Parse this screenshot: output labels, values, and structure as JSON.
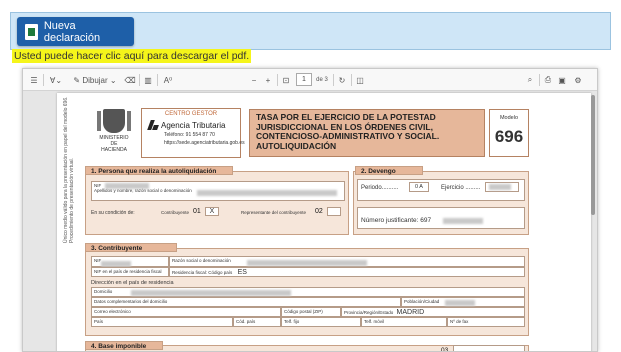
{
  "top": {
    "button_label": "Nueva declaración",
    "hint": "Usted puede hacer clic aquí para descargar el pdf."
  },
  "toolbar": {
    "draw_label": "Dibujar",
    "page_current": "1",
    "page_total": "de 3",
    "text_tool": "A⁰"
  },
  "form": {
    "side_text": "Único medio válido para la presentación en papel del modelo 696. Procedimiento de presentación virtual.",
    "crest_label": "MINISTERIO DE HACIENDA",
    "gestor_head": "CENTRO GESTOR",
    "agency": "Agencia Tributaria",
    "phone": "Teléfono: 91 554 87 70",
    "url": "https://sede.agenciatributaria.gob.es",
    "title": "TASA POR EL EJERCICIO DE LA POTESTAD JURISDICCIONAL EN LOS ÓRDENES CIVIL, CONTENCIOSO-ADMINISTRATIVO Y SOCIAL. AUTOLIQUIDACIÓN",
    "modelo_label": "Modelo",
    "modelo_num": "696",
    "s1_title": "1. Persona que realiza la autoliquidación",
    "s1_nif": "NIF",
    "s1_name": "Apellidos y nombre, razón social o denominación",
    "s1_cond": "En su condición de:",
    "s1_contrib": "Contribuyente",
    "s1_code1": "01",
    "s1_x1": "X",
    "s1_repr": "Representante del contribuyente",
    "s1_code2": "02",
    "s1_x2": "",
    "s2_title": "2. Devengo",
    "s2_periodo": "Periodo..........",
    "s2_per_val": "0 A",
    "s2_ejercicio": "Ejercicio .........",
    "s2_justif": "Número justificante: 697",
    "s3_title": "3. Contribuyente",
    "s3_nif": "NIF",
    "s3_razon": "Razón social o denominación",
    "s3_nif_res": "NIF en el país de residencia fiscal",
    "s3_res_fiscal": "Residencia fiscal: Código país",
    "s3_res_val": "ES",
    "s3_dir_head": "Dirección en el país de residencia",
    "s3_domicilio": "Domicilio",
    "s3_complement": "Datos complementarios del domicilio",
    "s3_poblacion": "Población/Ciudad",
    "s3_correo": "Correo electrónico",
    "s3_cp": "Código postal (ZIP)",
    "s3_provincia": "Provincia/Región/Estado",
    "s3_prov_val": "MADRID",
    "s3_pais": "País",
    "s3_cod_pais": "Cód. país",
    "s3_tel_fijo": "Telf. fijo",
    "s3_tel_movil": "Telf. móvil",
    "s3_fax": "Nº de fax",
    "s4_title": "4. Base imponible",
    "s4_code": "03"
  }
}
